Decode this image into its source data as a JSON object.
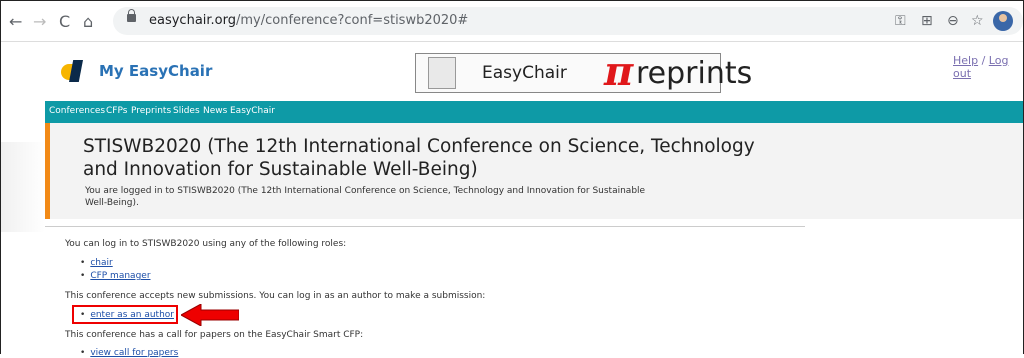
{
  "browser": {
    "back": "←",
    "forward": "→",
    "reload": "C",
    "home": "⌂",
    "url_host": "easychair.org",
    "url_path": "/my/conference?conf=stiswb2020#"
  },
  "header": {
    "brand": "My EasyChair",
    "banner_text": "EasyChair",
    "banner_pi": "π",
    "banner_suffix": "reprints",
    "help": "Help",
    "sep": " / ",
    "logout": "Log out"
  },
  "nav": {
    "items": [
      "Conferences",
      "CFPs",
      "Preprints",
      "Slides",
      "News",
      "EasyChair"
    ]
  },
  "title": {
    "heading": "STISWB2020 (The 12th International Conference on Science, Technology and Innovation for Sustainable Well-Being)",
    "subheading": "You are logged in to STISWB2020 (The 12th International Conference on Science, Technology and Innovation for Sustainable Well-Being)."
  },
  "content": {
    "roles_intro": "You can log in to STISWB2020 using any of the following roles:",
    "roles": [
      "chair",
      "CFP manager"
    ],
    "author_intro": "This conference accepts new submissions. You can log in as an author to make a submission:",
    "author_link": "enter as an author",
    "cfp_intro": "This conference has a call for papers on the EasyChair Smart CFP:",
    "cfp_link": "view call for papers"
  },
  "colors": {
    "nav_bg": "#0e9aa6",
    "accent": "#f28a17",
    "highlight": "#e00000"
  }
}
